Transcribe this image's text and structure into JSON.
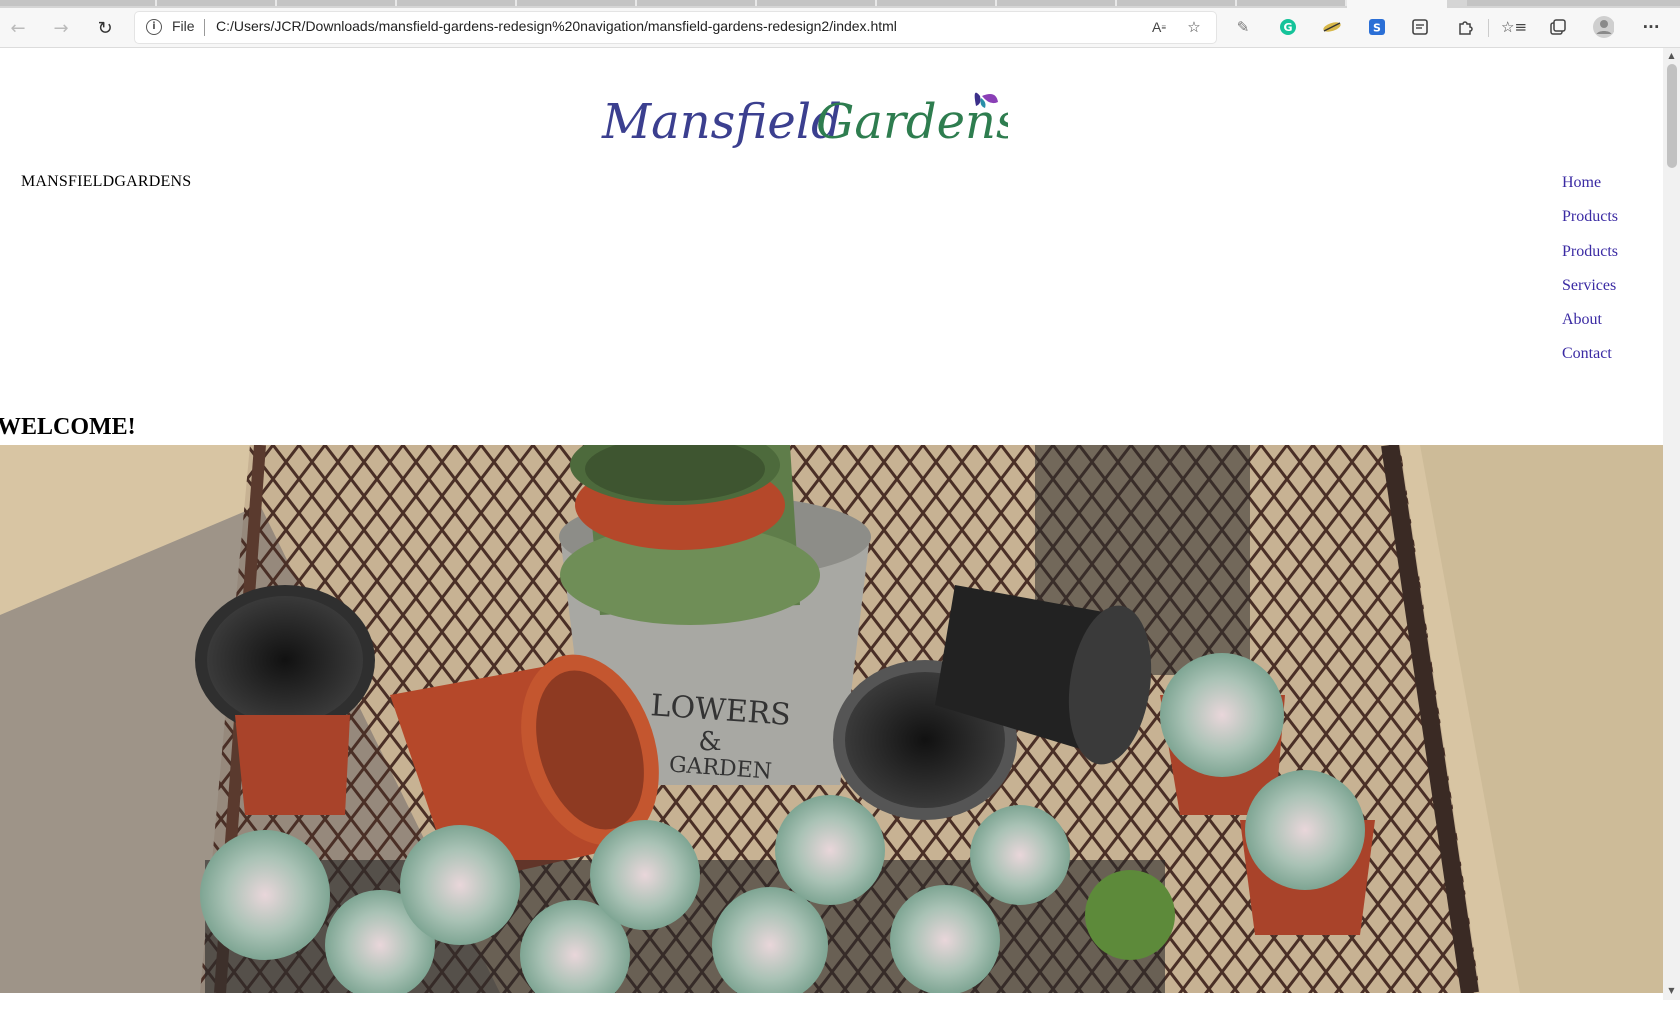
{
  "browser": {
    "address_scheme": "File",
    "url": "C:/Users/JCR/Downloads/mansfield-gardens-redesign%20navigation/mansfield-gardens-redesign2/index.html",
    "icons": [
      "back-icon",
      "forward-icon",
      "refresh-icon",
      "info-icon",
      "read-aloud-icon",
      "add-favorite-icon",
      "extension-pen-icon",
      "grammarly-icon",
      "extension-lens-icon",
      "extension-s-icon",
      "extension-page-icon",
      "extensions-puzzle-icon",
      "favorites-icon",
      "collections-icon",
      "profile-avatar-icon",
      "more-menu-icon"
    ]
  },
  "page": {
    "logo_alt": "Mansfield Gardens",
    "logo_word1": "Mansfield",
    "logo_word2": "Gardens",
    "brand_text": "MANSFIELDGARDENS",
    "nav": [
      "Home",
      "Products",
      "Products",
      "Services",
      "About",
      "Contact"
    ],
    "welcome": "WELCOME!",
    "hero_image": "plant-pots-and-succulents-photo",
    "hero_print_line1": "LOWERS",
    "hero_print_amp": "&",
    "hero_print_line2": "GARDEN"
  },
  "colors": {
    "logo_blue": "#3b3f8f",
    "logo_green": "#2e7d4f",
    "nav_link": "#3a2aa3",
    "terracotta": "#b5482a",
    "pot_green": "#5f7d4a",
    "succulent": "#a9c2b5"
  }
}
